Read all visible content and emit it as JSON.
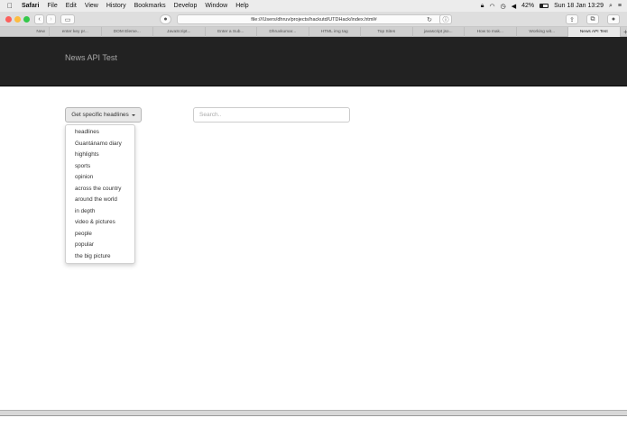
{
  "menubar": {
    "apple_icon": "apple-logo",
    "items": [
      "Safari",
      "File",
      "Edit",
      "View",
      "History",
      "Bookmarks",
      "Develop",
      "Window",
      "Help"
    ],
    "battery": "42%",
    "clock": "Sun 18 Jan  13:29"
  },
  "toolbar": {
    "address": "file:///Users/dhruv/projects/hackutd/UTDHack/index.html#",
    "reload_icon": "reload-icon",
    "traffic_colors": [
      "#fc605c",
      "#fdbc40",
      "#34c84a"
    ]
  },
  "tabs": [
    "New",
    "enter key pr...",
    "DOM Eleme...",
    "JavaScript...",
    "Enter a Sub...",
    "Dhruvkumar...",
    "HTML img tag",
    "Top Sites",
    "javascript jso...",
    "How to mak...",
    "Working wit...",
    "News API Test",
    "+"
  ],
  "navbar": {
    "brand": "News API Test",
    "bg": "#222222"
  },
  "dropdown": {
    "button_label": "Get specific headlines",
    "items": [
      "headlines",
      "Guantánamo diary",
      "highlights",
      "sports",
      "opinion",
      "across the country",
      "around the world",
      "in depth",
      "video & pictures",
      "people",
      "popular",
      "the big picture"
    ]
  },
  "search": {
    "placeholder": "Search.."
  }
}
